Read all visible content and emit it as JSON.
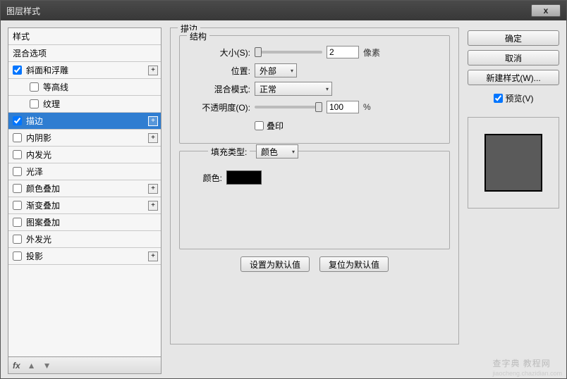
{
  "title": "图层样式",
  "close_glyph": "x",
  "sidebar": {
    "header_styles": "样式",
    "header_blend": "混合选项",
    "items": [
      {
        "label": "斜面和浮雕",
        "checked": true,
        "expandable": true,
        "sub": false,
        "selected": false
      },
      {
        "label": "等高线",
        "checked": false,
        "sub": true
      },
      {
        "label": "纹理",
        "checked": false,
        "sub": true
      },
      {
        "label": "描边",
        "checked": true,
        "expandable": true,
        "sub": false,
        "selected": true
      },
      {
        "label": "内阴影",
        "checked": false,
        "expandable": true,
        "sub": false
      },
      {
        "label": "内发光",
        "checked": false,
        "sub": false
      },
      {
        "label": "光泽",
        "checked": false,
        "sub": false
      },
      {
        "label": "颜色叠加",
        "checked": false,
        "expandable": true,
        "sub": false
      },
      {
        "label": "渐变叠加",
        "checked": false,
        "expandable": true,
        "sub": false
      },
      {
        "label": "图案叠加",
        "checked": false,
        "sub": false
      },
      {
        "label": "外发光",
        "checked": false,
        "sub": false
      },
      {
        "label": "投影",
        "checked": false,
        "expandable": true,
        "sub": false
      }
    ],
    "footer_fx": "fx"
  },
  "panel": {
    "group_title": "描边",
    "struct_title": "结构",
    "size_label": "大小(S):",
    "size_value": "2",
    "size_unit": "像素",
    "position_label": "位置:",
    "position_value": "外部",
    "blendmode_label": "混合模式:",
    "blendmode_value": "正常",
    "opacity_label": "不透明度(O):",
    "opacity_value": "100",
    "opacity_unit": "%",
    "overprint_label": "叠印",
    "filltype_label": "填充类型:",
    "filltype_value": "颜色",
    "color_label": "颜色:",
    "btn_default": "设置为默认值",
    "btn_reset": "复位为默认值"
  },
  "right": {
    "ok": "确定",
    "cancel": "取消",
    "newstyle": "新建样式(W)...",
    "preview_label": "预览(V)"
  },
  "watermark": {
    "main": "查字典 教程网",
    "sub": "jiaocheng.chazidian.com"
  }
}
